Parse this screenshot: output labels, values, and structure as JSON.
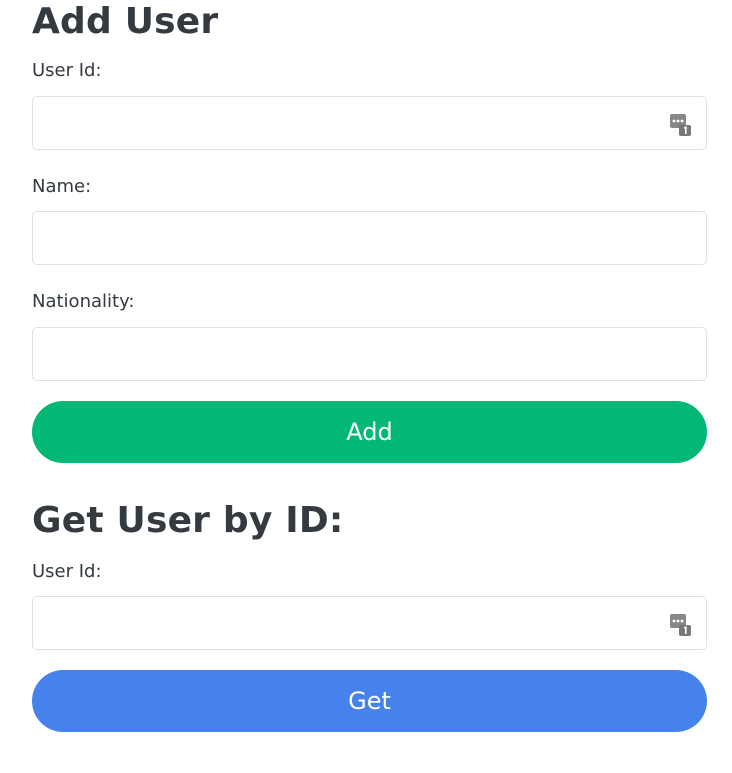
{
  "add_user": {
    "title": "Add User",
    "user_id_label": "User Id:",
    "user_id_value": "",
    "name_label": "Name:",
    "name_value": "",
    "nationality_label": "Nationality:",
    "nationality_value": "",
    "add_button_label": "Add",
    "add_button_color": "#02b875"
  },
  "get_user": {
    "title": "Get User by ID:",
    "user_id_label": "User Id:",
    "user_id_value": "",
    "get_button_label": "Get",
    "get_button_color": "#4582ec"
  },
  "icons": {
    "number_field_icon": "numeric-input-icon"
  }
}
